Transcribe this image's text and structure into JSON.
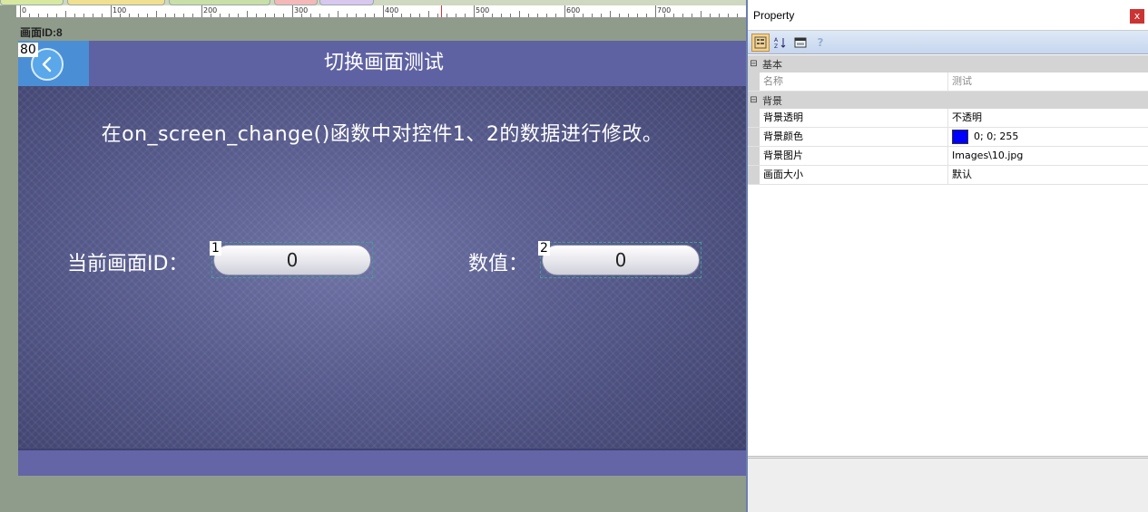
{
  "editor": {
    "screen_id_label": "画面ID:8",
    "ruler_labels": [
      "0",
      "100",
      "200",
      "300",
      "400",
      "500",
      "600",
      "700"
    ]
  },
  "canvas": {
    "back_control_id": "80",
    "title": "切换画面测试",
    "description": "在on_screen_change()函数中对控件1、2的数据进行修改。",
    "fields": [
      {
        "control_id": "1",
        "label": "当前画面ID：",
        "value": "0"
      },
      {
        "control_id": "2",
        "label": "数值：",
        "value": "0"
      }
    ]
  },
  "property_panel": {
    "title": "Property",
    "close_label": "x",
    "toolbar_icons": [
      "categorized-icon",
      "sort-az-icon",
      "property-page-icon",
      "help-icon"
    ],
    "categories": [
      {
        "label": "基本",
        "rows": [
          {
            "name": "名称",
            "value": "测试",
            "dim": true
          }
        ]
      },
      {
        "label": "背景",
        "rows": [
          {
            "name": "背景透明",
            "value": "不透明"
          },
          {
            "name": "背景颜色",
            "value": "0; 0; 255",
            "swatch": "#0000ff"
          },
          {
            "name": "背景图片",
            "value": "Images\\10.jpg"
          },
          {
            "name": "画面大小",
            "value": "默认"
          }
        ]
      }
    ]
  }
}
